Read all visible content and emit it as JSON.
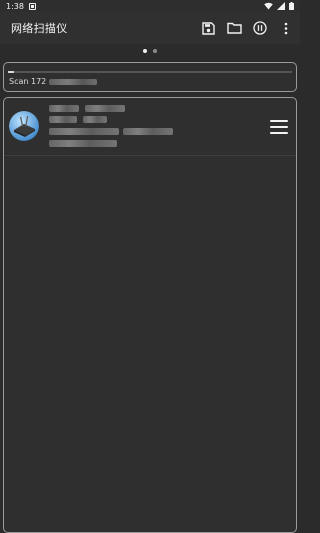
{
  "status_bar": {
    "time": "1:38",
    "icons": [
      "notification-icon",
      "wifi-icon",
      "signal-icon",
      "battery-icon"
    ]
  },
  "app_bar": {
    "title": "网络扫描仪",
    "actions": [
      "save-icon",
      "folder-icon",
      "pause-icon",
      "more-vert-icon"
    ]
  },
  "pager": {
    "pages": 2,
    "active": 0
  },
  "scan": {
    "label": "Scan 172",
    "progress": 0.02
  },
  "devices": [
    {
      "icon": "router-icon",
      "menu_icon": "hamburger-menu-icon"
    }
  ],
  "colors": {
    "background": "#2b2b2b",
    "panel_border": "#9a9a9a",
    "text": "#e8e8e8"
  }
}
